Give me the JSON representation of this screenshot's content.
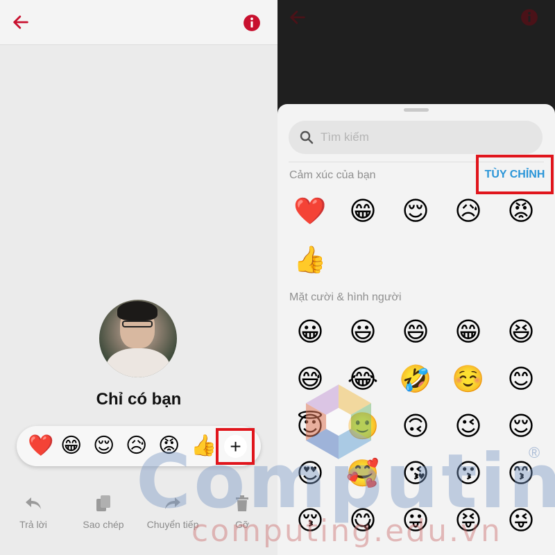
{
  "left_panel": {
    "header": {
      "back_icon": "arrow-left-icon",
      "info_icon": "info-circle-icon",
      "accent_color": "#c8102e"
    },
    "profile": {
      "name": "Chỉ có bạn"
    },
    "reaction_bar": {
      "emojis": [
        "❤️",
        "😁",
        "😌",
        "😥",
        "😡",
        "👍"
      ],
      "more_button": "+"
    },
    "actions": [
      {
        "label": "Trả lời",
        "icon": "reply-icon"
      },
      {
        "label": "Sao chép",
        "icon": "copy-icon"
      },
      {
        "label": "Chuyển tiếp",
        "icon": "forward-icon"
      },
      {
        "label": "Gỡ",
        "icon": "trash-icon"
      }
    ]
  },
  "right_panel": {
    "search": {
      "placeholder": "Tìm kiếm",
      "icon": "search-icon"
    },
    "your_reactions": {
      "title": "Cảm xúc của bạn",
      "customize_label": "TÙY CHỈNH",
      "emojis": [
        "❤️",
        "😁",
        "😌",
        "😥",
        "😡",
        "👍"
      ]
    },
    "smileys": {
      "title": "Mặt cười & hình người",
      "emojis": [
        "😀",
        "😃",
        "😄",
        "😁",
        "😆",
        "😅",
        "😂",
        "🤣",
        "☺️",
        "😊",
        "😇",
        "🙂",
        "🙃",
        "😉",
        "😌",
        "😍",
        "🥰",
        "😘",
        "😗",
        "😙",
        "😚",
        "😋",
        "😛",
        "😝",
        "😜"
      ]
    }
  },
  "watermark": {
    "brand": "Computing",
    "url": "computing.edu.vn",
    "registered": "®"
  }
}
